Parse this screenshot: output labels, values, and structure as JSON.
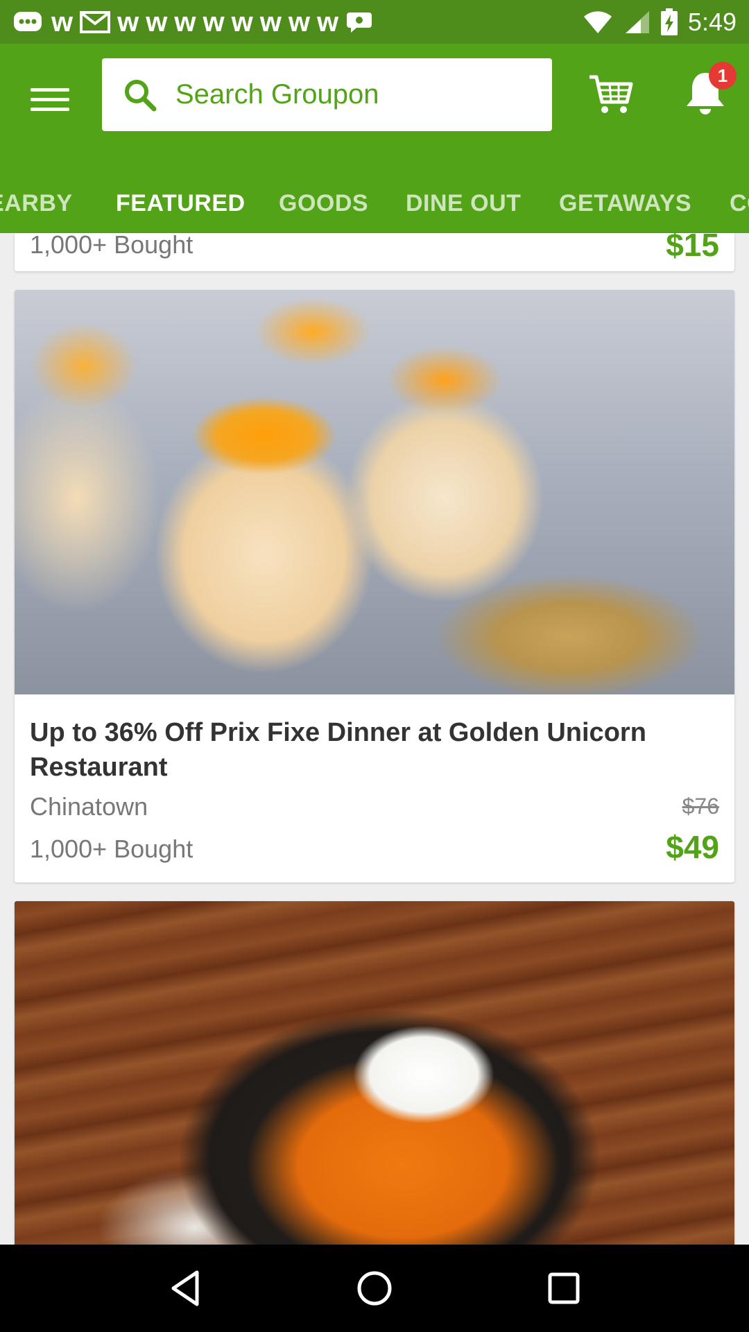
{
  "status_bar": {
    "time": "5:49",
    "notification_icons": [
      "message-icon",
      "w-icon",
      "gmail-icon",
      "w-icon",
      "w-icon",
      "w-icon",
      "w-icon",
      "w-icon",
      "w-icon",
      "w-icon",
      "w-icon",
      "w-icon",
      "chat-icon"
    ]
  },
  "header": {
    "search_placeholder": "Search Groupon",
    "notification_count": "1"
  },
  "tabs": [
    {
      "label": "NEARBY"
    },
    {
      "label": "FEATURED",
      "active": true
    },
    {
      "label": "GOODS"
    },
    {
      "label": "DINE OUT"
    },
    {
      "label": "GETAWAYS"
    },
    {
      "label": "COUPONS"
    }
  ],
  "previous_card": {
    "bought": "1,000+ Bought",
    "price": "$15"
  },
  "deal": {
    "title": "Up to 36% Off Prix Fixe Dinner at Golden Unicorn Restaurant",
    "location": "Chinatown",
    "bought": "1,000+ Bought",
    "original_price": "$76",
    "price": "$49"
  },
  "colors": {
    "brand_green": "#53a318",
    "status_bar": "#4e8d1b",
    "badge_red": "#e53935"
  }
}
